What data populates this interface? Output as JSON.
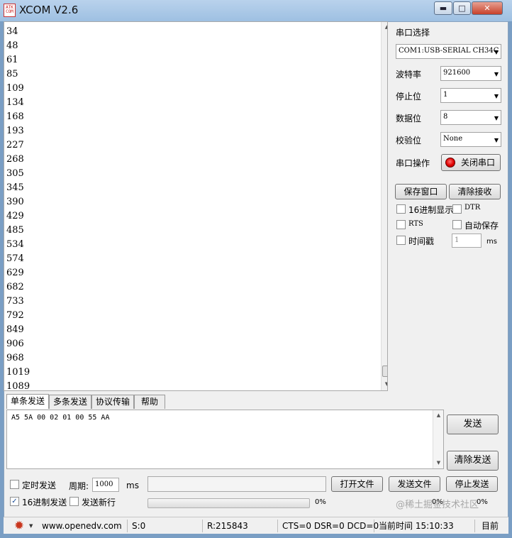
{
  "window": {
    "icon_text": [
      "ATK",
      "COM"
    ],
    "title": "XCOM V2.6",
    "controls": {
      "minimize": "▬",
      "maximize": "□",
      "close": "✕"
    }
  },
  "receive": {
    "lines": [
      "34",
      "48",
      "61",
      "85",
      "109",
      "134",
      "168",
      "193",
      "227",
      "268",
      "305",
      "345",
      "390",
      "429",
      "485",
      "534",
      "574",
      "629",
      "682",
      "733",
      "792",
      "849",
      "906",
      "968",
      "1019",
      "1089"
    ]
  },
  "settings": {
    "port_label": "串口选择",
    "port_value": "COM1:USB-SERIAL CH34C",
    "baud_label": "波特率",
    "baud_value": "921600",
    "stopbits_label": "停止位",
    "stopbits_value": "1",
    "databits_label": "数据位",
    "databits_value": "8",
    "parity_label": "校验位",
    "parity_value": "None",
    "port_op_label": "串口操作",
    "close_port_button": "关闭串口",
    "save_window_button": "保存窗口",
    "clear_receive_button": "清除接收",
    "hex_display_label": "16进制显示",
    "dtr_label": "DTR",
    "rts_label": "RTS",
    "auto_save_label": "自动保存",
    "timestamp_label": "时间戳",
    "timestamp_value": "1",
    "timestamp_unit": "ms"
  },
  "tabs": [
    "单条发送",
    "多条发送",
    "协议传输",
    "帮助"
  ],
  "send": {
    "text": "A5 5A 00 02 01 00 55 AA",
    "send_button": "发送",
    "clear_send_button": "清除发送",
    "timed_send_label": "定时发送",
    "period_label": "周期:",
    "period_value": "1000",
    "period_unit": "ms",
    "open_file_button": "打开文件",
    "send_file_button": "发送文件",
    "stop_send_button": "停止发送",
    "hex_send_label": "16进制发送",
    "hex_send_checked": true,
    "newline_label": "发送新行",
    "progress_text": "0%",
    "progress_text2": "0%",
    "progress_text3": "0%",
    "progress": 0
  },
  "status": {
    "url": "www.openedv.com",
    "sent": "S:0",
    "received": "R:215843",
    "lines": "CTS=0 DSR=0 DCD=0",
    "time": "当前时间 15:10:33",
    "right": "目前"
  },
  "watermark": "@稀土掘金技术社区",
  "colors": {
    "title_bg": "#a9c8e8",
    "close_btn": "#c7412b",
    "led": "#e00000"
  }
}
